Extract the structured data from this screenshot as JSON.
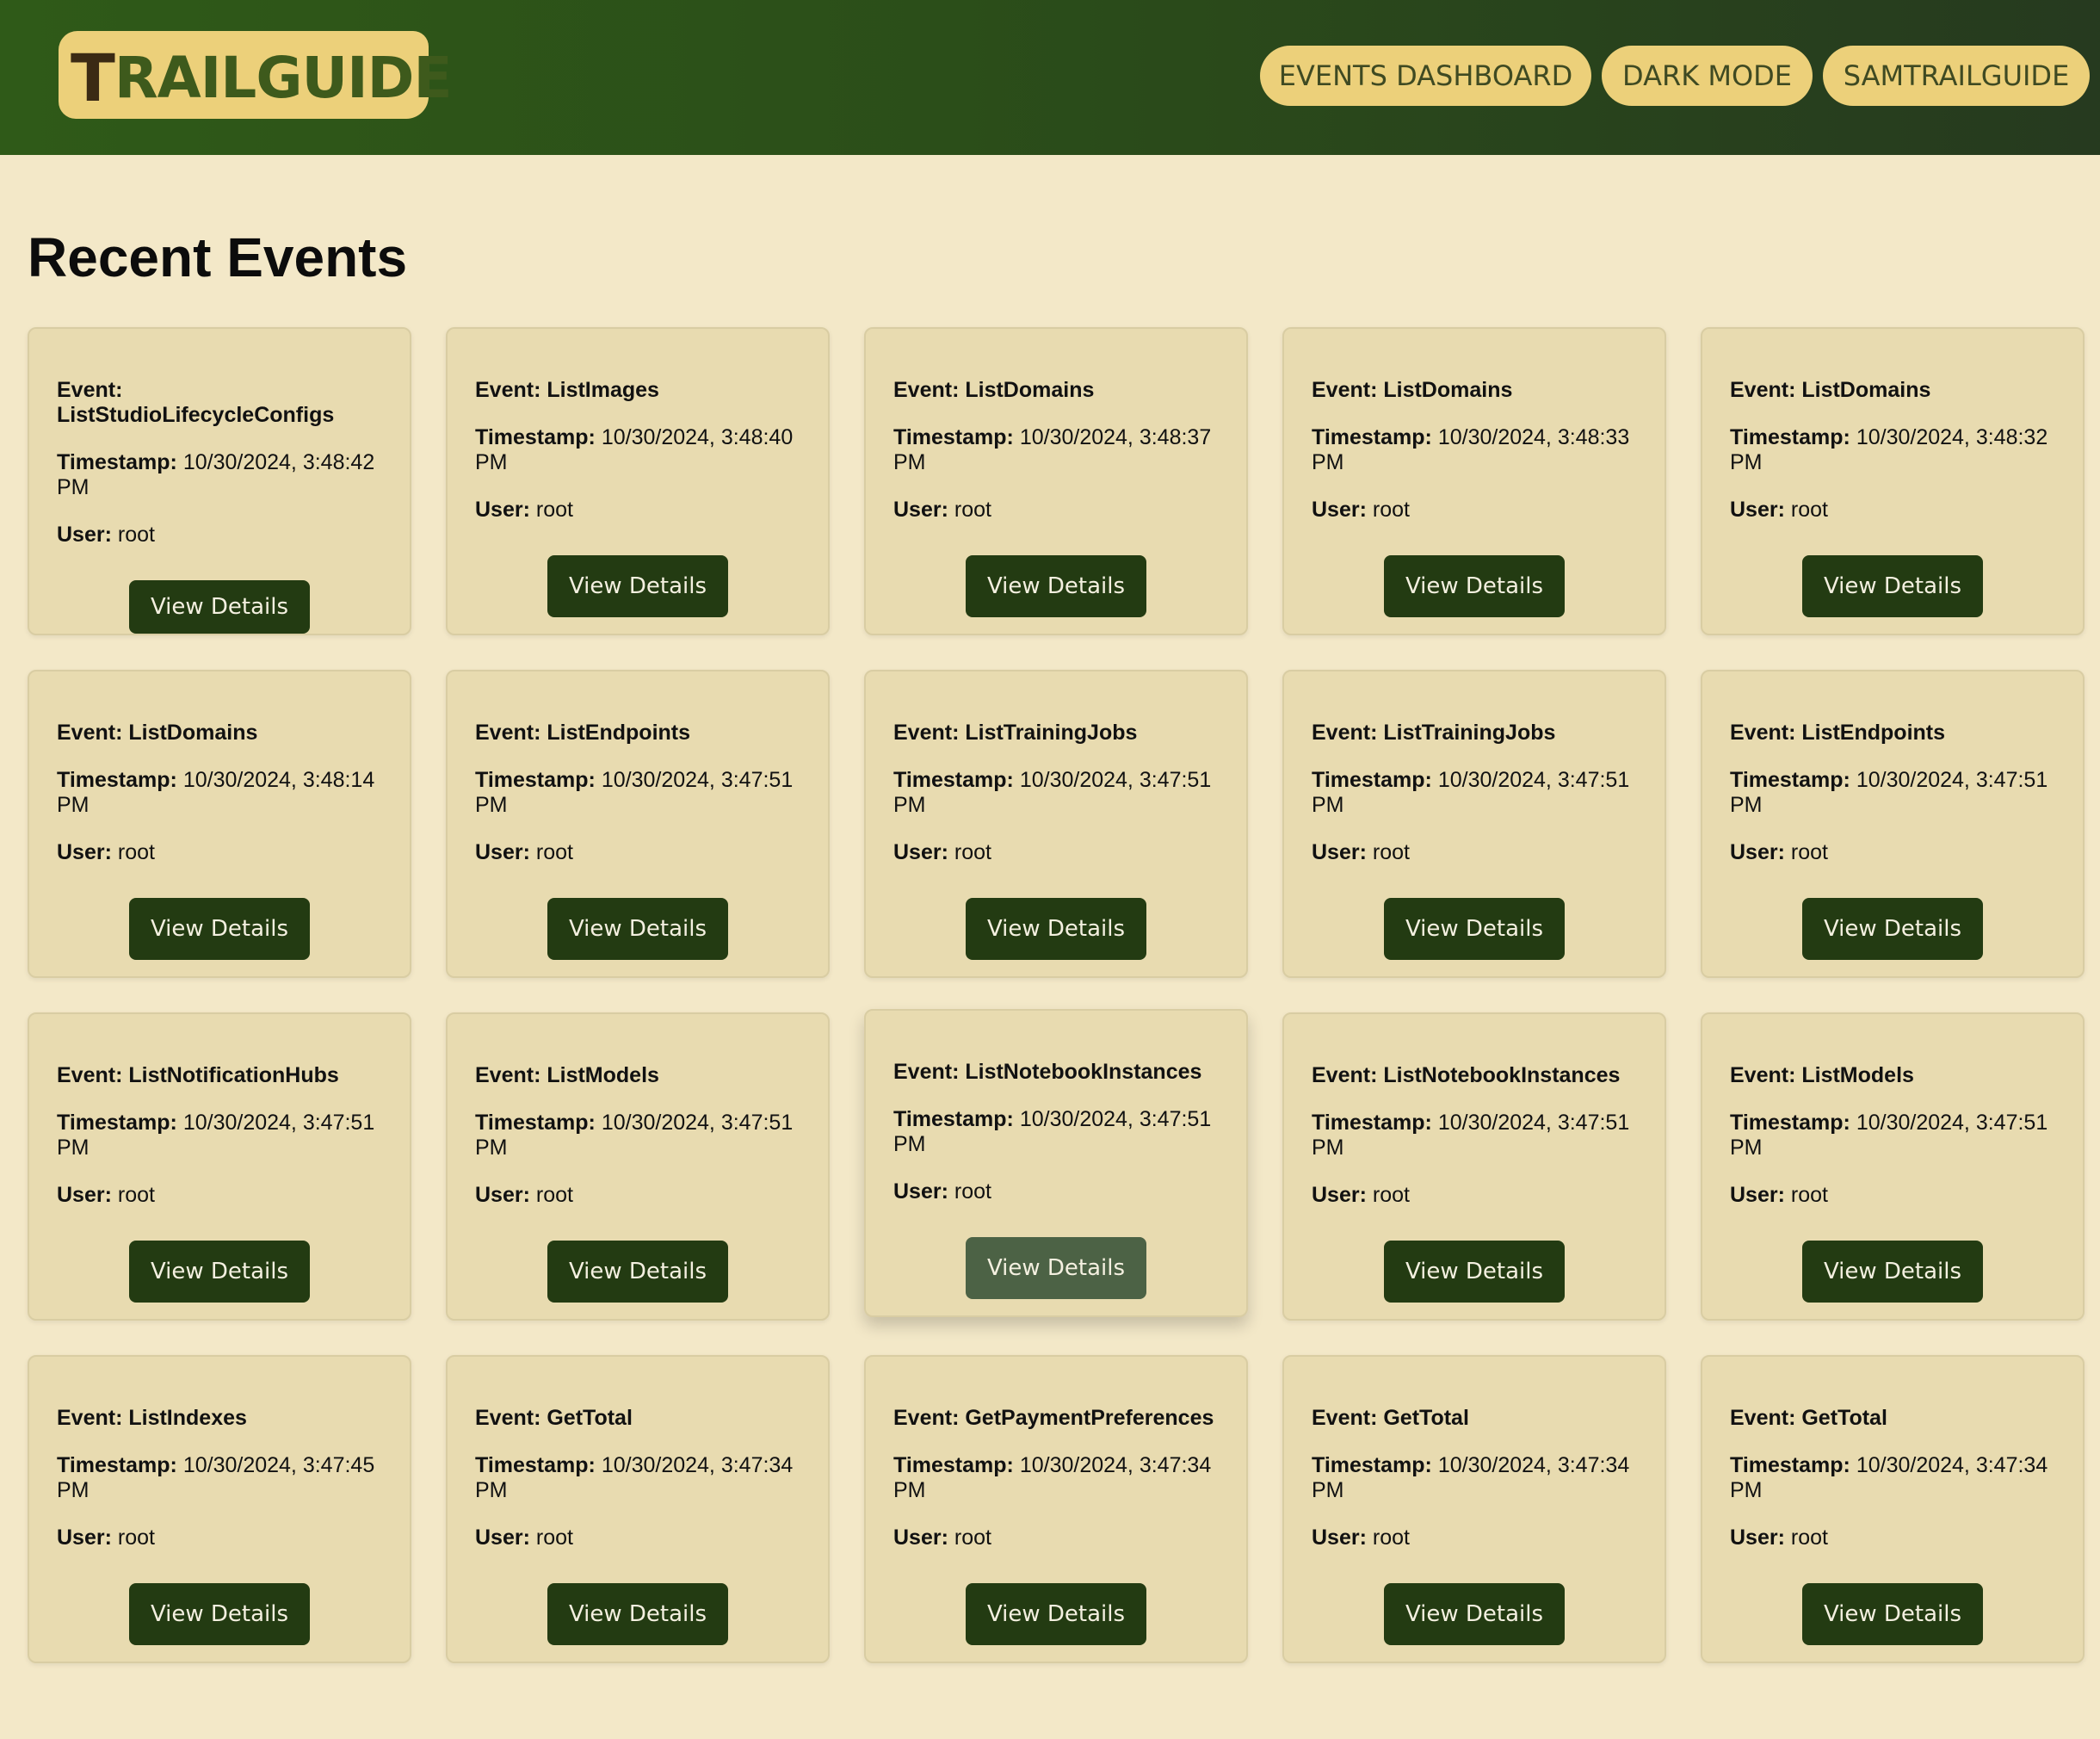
{
  "header": {
    "logo_first": "T",
    "logo_rest": "RAILGUIDE",
    "nav": [
      "EVENTS DASHBOARD",
      "DARK MODE",
      "SAMTRAILGUIDE"
    ]
  },
  "page_title": "Recent Events",
  "labels": {
    "event": "Event:",
    "timestamp": "Timestamp:",
    "user": "User:",
    "button": "View Details"
  },
  "events": [
    {
      "name": "ListStudioLifecycleConfigs",
      "timestamp": "10/30/2024, 3:48:42 PM",
      "user": "root"
    },
    {
      "name": "ListImages",
      "timestamp": "10/30/2024, 3:48:40 PM",
      "user": "root"
    },
    {
      "name": "ListDomains",
      "timestamp": "10/30/2024, 3:48:37 PM",
      "user": "root"
    },
    {
      "name": "ListDomains",
      "timestamp": "10/30/2024, 3:48:33 PM",
      "user": "root"
    },
    {
      "name": "ListDomains",
      "timestamp": "10/30/2024, 3:48:32 PM",
      "user": "root"
    },
    {
      "name": "ListDomains",
      "timestamp": "10/30/2024, 3:48:14 PM",
      "user": "root"
    },
    {
      "name": "ListEndpoints",
      "timestamp": "10/30/2024, 3:47:51 PM",
      "user": "root"
    },
    {
      "name": "ListTrainingJobs",
      "timestamp": "10/30/2024, 3:47:51 PM",
      "user": "root"
    },
    {
      "name": "ListTrainingJobs",
      "timestamp": "10/30/2024, 3:47:51 PM",
      "user": "root"
    },
    {
      "name": "ListEndpoints",
      "timestamp": "10/30/2024, 3:47:51 PM",
      "user": "root"
    },
    {
      "name": "ListNotificationHubs",
      "timestamp": "10/30/2024, 3:47:51 PM",
      "user": "root"
    },
    {
      "name": "ListModels",
      "timestamp": "10/30/2024, 3:47:51 PM",
      "user": "root"
    },
    {
      "name": "ListNotebookInstances",
      "timestamp": "10/30/2024, 3:47:51 PM",
      "user": "root",
      "hovered": true
    },
    {
      "name": "ListNotebookInstances",
      "timestamp": "10/30/2024, 3:47:51 PM",
      "user": "root"
    },
    {
      "name": "ListModels",
      "timestamp": "10/30/2024, 3:47:51 PM",
      "user": "root"
    },
    {
      "name": "ListIndexes",
      "timestamp": "10/30/2024, 3:47:45 PM",
      "user": "root"
    },
    {
      "name": "GetTotal",
      "timestamp": "10/30/2024, 3:47:34 PM",
      "user": "root"
    },
    {
      "name": "GetPaymentPreferences",
      "timestamp": "10/30/2024, 3:47:34 PM",
      "user": "root"
    },
    {
      "name": "GetTotal",
      "timestamp": "10/30/2024, 3:47:34 PM",
      "user": "root"
    },
    {
      "name": "GetTotal",
      "timestamp": "10/30/2024, 3:47:34 PM",
      "user": "root"
    }
  ],
  "colors": {
    "header_start": "#2f5a18",
    "header_end": "#263a1f",
    "accent_yellow": "#ecd07a",
    "background": "#f3e8c8",
    "card": "#e8dbb0",
    "button": "#233b12",
    "button_hover": "#4c6245"
  }
}
